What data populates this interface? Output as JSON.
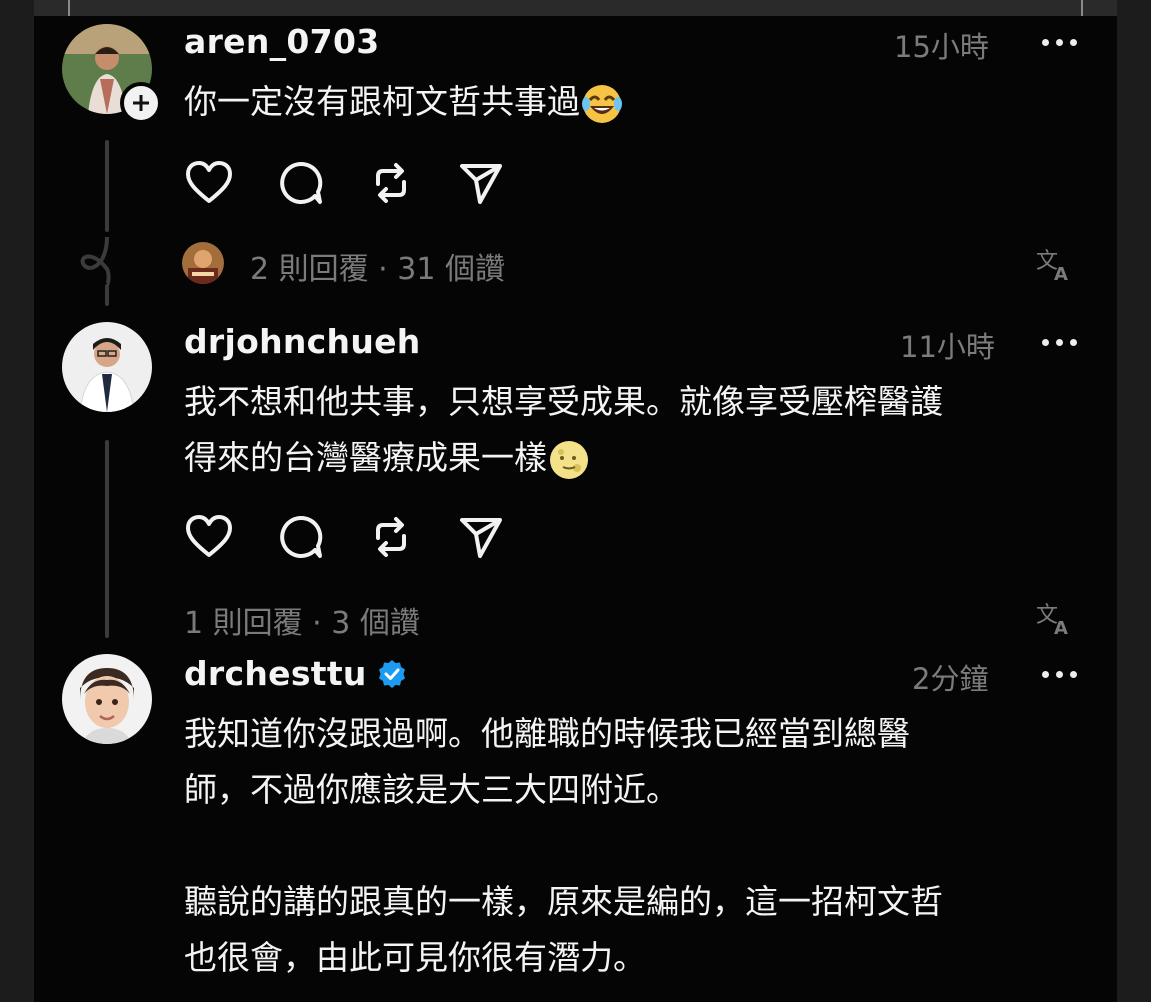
{
  "comments": [
    {
      "username": "aren_0703",
      "time": "15小時",
      "text": "你一定沒有跟柯文哲共事過",
      "emoji": "face-with-tears-of-joy",
      "meta": "2 則回覆 · 31 個讚"
    },
    {
      "username": "drjohnchueh",
      "time": "11小時",
      "text_line1": "我不想和他共事，只想享受成果。就像享受壓榨醫護",
      "text_line2": "得來的台灣醫療成果一樣",
      "emoji": "full-moon-face",
      "meta": "1 則回覆 · 3 個讚"
    },
    {
      "username": "drchesttu",
      "verified": true,
      "time": "2分鐘",
      "text_line1": "我知道你沒跟過啊。他離職的時候我已經當到總醫",
      "text_line2": "師，不過你應該是大三大四附近。",
      "text_line3": "聽說的講的跟真的一樣，原來是編的，這一招柯文哲",
      "text_line4": "也很會，由此可見你很有潛力。"
    }
  ],
  "colors": {
    "background": "#050505",
    "text": "#f4f4f4",
    "muted": "#7b7b7b",
    "verified": "#1d9bf0"
  }
}
